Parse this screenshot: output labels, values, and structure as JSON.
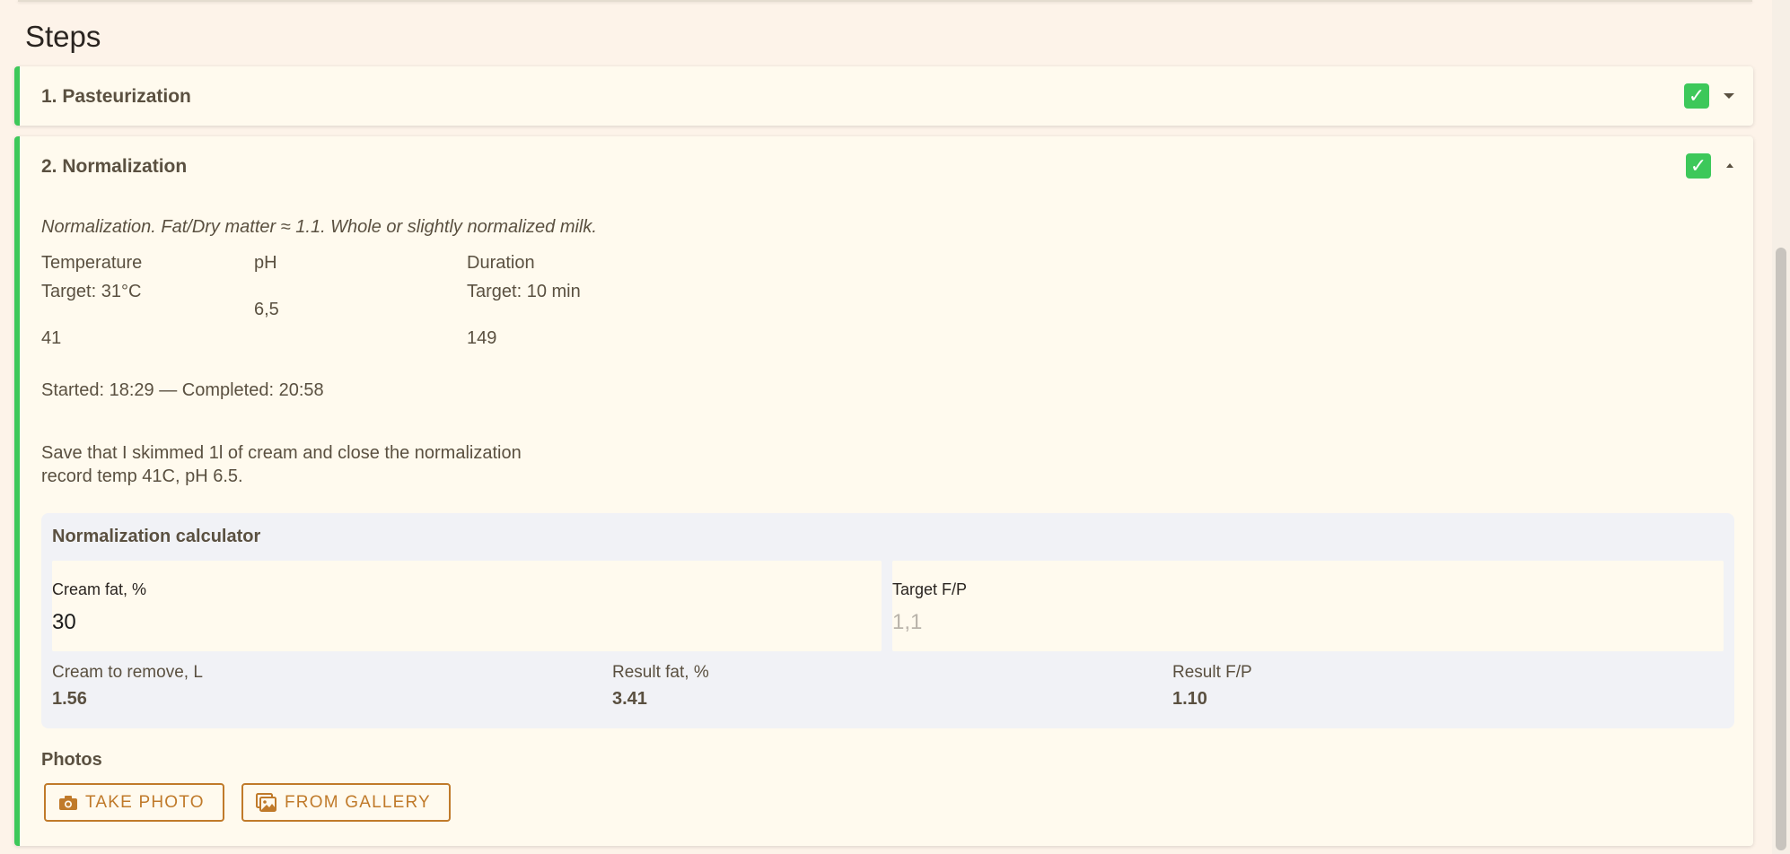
{
  "section_title": "Steps",
  "steps": [
    {
      "title": "1. Pasteurization",
      "completed": true,
      "expanded": false
    },
    {
      "title": "2. Normalization",
      "completed": true,
      "expanded": true,
      "description": "Normalization. Fat/Dry matter ≈ 1.1. Whole or slightly normalized milk.",
      "params": {
        "temperature": {
          "label": "Temperature",
          "target": "Target: 31°C",
          "measured": "41"
        },
        "ph": {
          "label": "pH",
          "value": "6,5"
        },
        "duration": {
          "label": "Duration",
          "target": "Target: 10 min",
          "measured": "149"
        }
      },
      "times": "Started: 18:29 — Completed: 20:58",
      "note_line1": "Save that I skimmed 1l of cream and close the normalization",
      "note_line2": "record temp 41C, pH 6.5.",
      "calculator": {
        "title": "Normalization calculator",
        "cream_fat": {
          "label": "Cream fat, %",
          "value": "30"
        },
        "target_fp": {
          "label": "Target F/P",
          "placeholder": "1,1"
        },
        "results": [
          {
            "label": "Cream to remove, L",
            "value": "1.56"
          },
          {
            "label": "Result fat, %",
            "value": "3.41"
          },
          {
            "label": "Result F/P",
            "value": "1.10"
          }
        ]
      },
      "photos": {
        "label": "Photos",
        "take_photo": "TAKE PHOTO",
        "from_gallery": "FROM GALLERY"
      }
    }
  ],
  "icons": {
    "check": "✓",
    "camera": "camera-icon",
    "gallery": "gallery-icon"
  },
  "colors": {
    "accent_green": "#3dc85a",
    "button_orange": "#c07a2a",
    "card_bg": "#fffaee",
    "calc_bg": "#f1f2f6",
    "page_bg": "#fdf3e9"
  }
}
